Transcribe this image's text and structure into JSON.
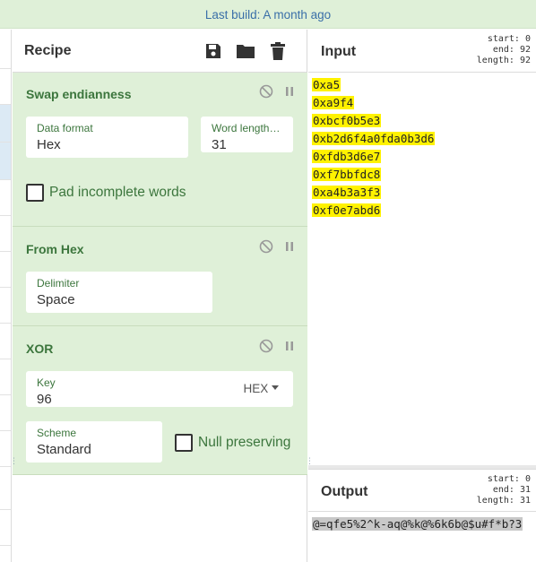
{
  "banner": {
    "text": "Last build: A month ago"
  },
  "recipe": {
    "title": "Recipe",
    "tools": {
      "save": "save-icon",
      "load": "folder-icon",
      "clear": "trash-icon"
    }
  },
  "operations": {
    "swap": {
      "title": "Swap endianness",
      "data_format_label": "Data format",
      "data_format_value": "Hex",
      "word_length_label": "Word length (bytes)",
      "word_length_value": "31",
      "pad_label": "Pad incomplete words"
    },
    "fromhex": {
      "title": "From Hex",
      "delimiter_label": "Delimiter",
      "delimiter_value": "Space"
    },
    "xor": {
      "title": "XOR",
      "key_label": "Key",
      "key_value": "96",
      "key_type": "HEX",
      "scheme_label": "Scheme",
      "scheme_value": "Standard",
      "null_label": "Null preserving"
    }
  },
  "input": {
    "title": "Input",
    "start": "start:  0",
    "end": "end: 92",
    "length": "length: 92",
    "lines": [
      "0xa5",
      "0xa9f4",
      "0xbcf0b5e3",
      "0xb2d6f4a0fda0b3d6",
      "0xfdb3d6e7",
      "0xf7bbfdc8",
      "0xa4b3a3f3",
      "0xf0e7abd6"
    ]
  },
  "output": {
    "title": "Output",
    "start": "start:  0",
    "end": "end: 31",
    "length": "length: 31",
    "text": "@=qfe5%2^k-aq@%k@%6k6b@$u#f*b?3"
  },
  "colors": {
    "op_bg": "#dff0d8",
    "op_title": "#3c763d",
    "highlight": "#fff200"
  }
}
